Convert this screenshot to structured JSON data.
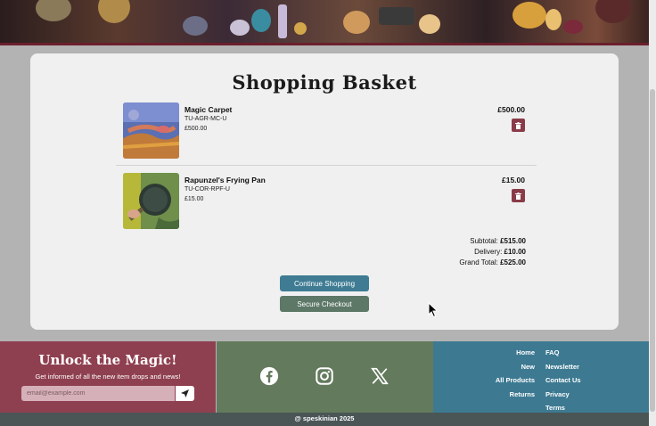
{
  "page": {
    "title": "Shopping Basket"
  },
  "basket": {
    "items": [
      {
        "name": "Magic Carpet",
        "sku": "TU-AGR-MC-U",
        "unit_price": "£500.00",
        "line_total": "£500.00",
        "delete_icon": "trash-icon"
      },
      {
        "name": "Rapunzel's Frying Pan",
        "sku": "TU-COR-RPF-U",
        "unit_price": "£15.00",
        "line_total": "£15.00",
        "delete_icon": "trash-icon"
      }
    ],
    "totals": {
      "subtotal_label": "Subtotal:",
      "subtotal": "£515.00",
      "delivery_label": "Delivery:",
      "delivery": "£10.00",
      "grand_total_label": "Grand Total:",
      "grand_total": "£525.00"
    },
    "continue_label": "Continue Shopping",
    "checkout_label": "Secure Checkout"
  },
  "footer": {
    "newsletter_title": "Unlock the Magic!",
    "newsletter_text": "Get informed of all the new item drops and news!",
    "email_placeholder": "email@example.com",
    "send_icon": "paper-plane-icon",
    "social": [
      "facebook-icon",
      "instagram-icon",
      "x-icon"
    ],
    "links_left": [
      "Home",
      "New",
      "All Products",
      "Returns"
    ],
    "links_right": [
      "FAQ",
      "Newsletter",
      "Contact Us",
      "Privacy",
      "Terms"
    ],
    "copyright": "@ speskinian 2025"
  },
  "colors": {
    "card_bg": "#f0f0f0",
    "trash_button": "#8a3b48",
    "continue_button": "#3f7c93",
    "checkout_button": "#5e7867",
    "footer_left": "#8f4050",
    "footer_middle": "#637a5d",
    "footer_right": "#3d7a92",
    "copyright_bar": "#4a5556"
  }
}
